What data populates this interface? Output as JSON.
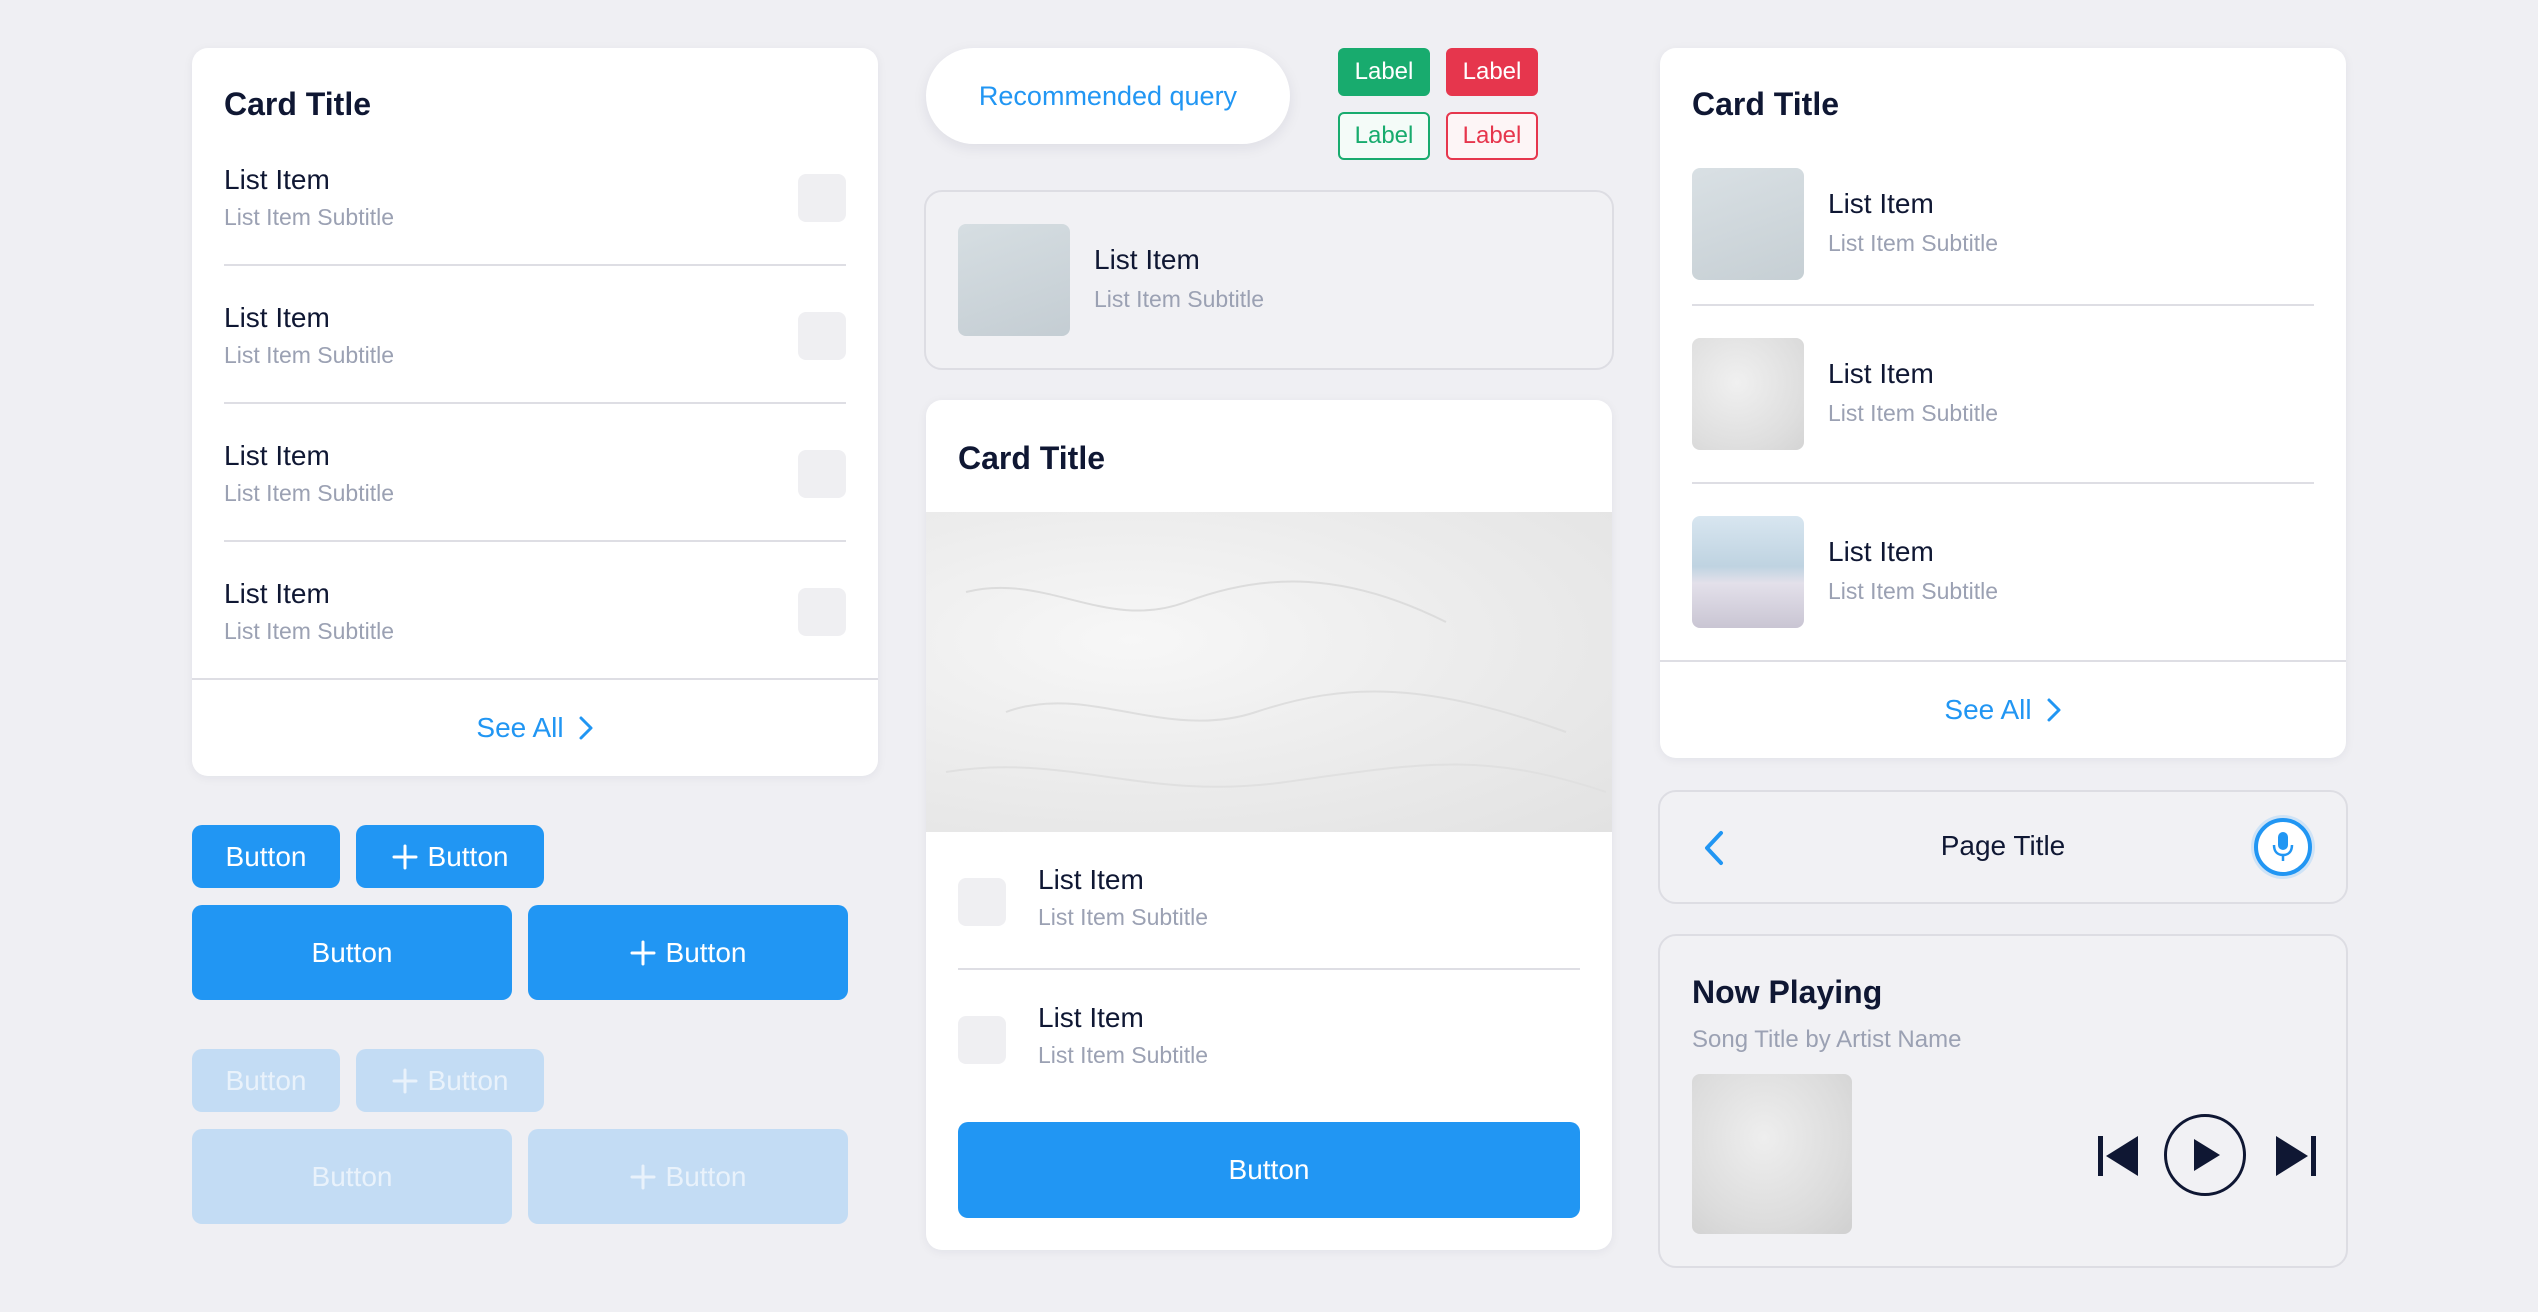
{
  "colors": {
    "primary": "#2196f3",
    "primary_disabled": "#c3dcf4",
    "success": "#18ab6e",
    "danger": "#e6364d",
    "text": "#0f1733",
    "subtitle": "#9ba1b3",
    "background": "#efeff3"
  },
  "left_card": {
    "title": "Card Title",
    "items": [
      {
        "title": "List Item",
        "subtitle": "List Item Subtitle"
      },
      {
        "title": "List Item",
        "subtitle": "List Item Subtitle"
      },
      {
        "title": "List Item",
        "subtitle": "List Item Subtitle"
      },
      {
        "title": "List Item",
        "subtitle": "List Item Subtitle"
      }
    ],
    "see_all": "See All",
    "see_all_icon": "chevron-right-icon"
  },
  "buttons": {
    "small_label": "Button",
    "small_plus_label": "Button",
    "large_label": "Button",
    "large_plus_label": "Button",
    "disabled_small_label": "Button",
    "disabled_small_plus_label": "Button",
    "disabled_large_label": "Button",
    "disabled_large_plus_label": "Button",
    "plus_icon": "plus-icon"
  },
  "chip": {
    "label": "Recommended query"
  },
  "badges": [
    {
      "label": "Label",
      "style": "solid-success"
    },
    {
      "label": "Label",
      "style": "solid-danger"
    },
    {
      "label": "Label",
      "style": "outline-success"
    },
    {
      "label": "Label",
      "style": "outline-danger"
    }
  ],
  "outlined_list_item": {
    "title": "List Item",
    "subtitle": "List Item Subtitle"
  },
  "center_card": {
    "title": "Card Title",
    "items": [
      {
        "title": "List Item",
        "subtitle": "List Item Subtitle"
      },
      {
        "title": "List Item",
        "subtitle": "List Item Subtitle"
      }
    ],
    "button_label": "Button"
  },
  "right_card": {
    "title": "Card Title",
    "items": [
      {
        "title": "List Item",
        "subtitle": "List Item Subtitle"
      },
      {
        "title": "List Item",
        "subtitle": "List Item Subtitle"
      },
      {
        "title": "List Item",
        "subtitle": "List Item Subtitle"
      }
    ],
    "see_all": "See All",
    "see_all_icon": "chevron-right-icon"
  },
  "nav_bar": {
    "title": "Page Title",
    "back_icon": "chevron-left-icon",
    "mic_icon": "microphone-icon"
  },
  "now_playing": {
    "title": "Now Playing",
    "subtitle": "Song Title by Artist Name",
    "prev_icon": "skip-previous-icon",
    "play_icon": "play-icon",
    "next_icon": "skip-next-icon"
  }
}
